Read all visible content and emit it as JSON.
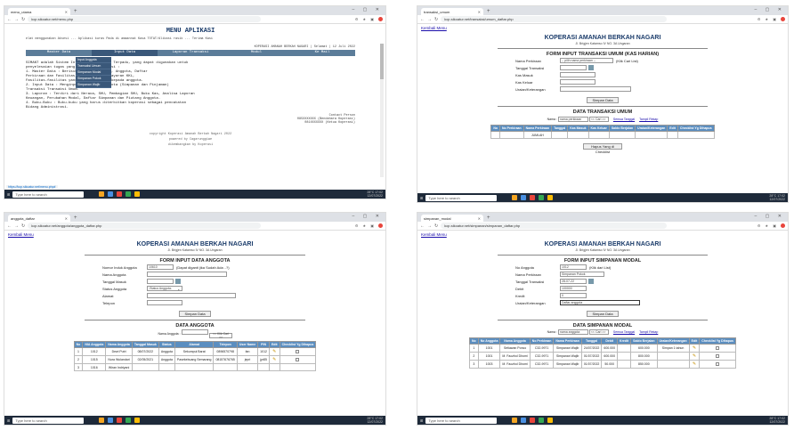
{
  "screen1": {
    "tab_title": "menu_utama",
    "url": "kop.sikoatur.net/menu.php",
    "menu_title": "MENU APLIKASI",
    "marquee_text": "elat menggunakan Aksesi ... Aplikasi kuras Pada di amaannat Kasa TOTAT/Alikasi rasik ... Terima Kasi",
    "header_line": "KOPERASI AMANAH BERKAH NAGARI | Selamat | 12 Juli 2022",
    "nav": [
      "Master Data",
      "Input Data",
      "Laporan Transaksi",
      "Modul",
      "Ke Mail"
    ],
    "dropdown": [
      "Input Anggota",
      "Transaksi Umum",
      "Simpanan Modal",
      "Simpanan Pokok",
      "Simpanan Wajib"
    ],
    "body_lines": [
      "SIMANT adalah Sistem Informasi Manajemen Terpadu, yang dapat digunakan untuk",
      "penyelesaian tugas yang dilakukan Aplikasi :",
      "1. Master Data : Berisikan Data Koperasi, Anggota, Daftar",
      "   Perkiraan dan Fasilitas, Pencatatan Pembayaran KKL,",
      "   Fasilitas-fasilitas yang akan diberikan kepada anggota.",
      "2. Input Data : Menginput Transaksi Anggota (Simpanan dan Pinjaman)",
      "   Transaksi Transaksi Umum.",
      "3. Laporan : Terdiri dari Neraca, SHU, Pembagian SHU, Buku Kas, Analisa Laporan",
      "   Keuangan, Perubahan Modal, Daftar Simpanan dan Piutang Anggota.",
      "4. Buku-Buku : Buku-buku yang harus diterbitkan koperasi sebagai pencatatan",
      "   Bidang Administrasi."
    ],
    "footer_right": [
      "Contact Person",
      "085XXXXXXX (Bendahara Koperasi)",
      "081XXXXXXX (Ketua Koperasi)"
    ],
    "credits": [
      "copyright Koperasi Amanah Berkah Nagari 2022",
      "powered by Cagarunggiwe",
      "dikembangkan by Koperasi"
    ],
    "status_url": "https://kop.sikoatur.net/menu.php#"
  },
  "screen2": {
    "tab_title": "transaksi_umum",
    "url": "kop.sikoatur.net/transaksi/umum_daftar.php",
    "back_link": "Kembali Menu",
    "coop_name": "KOPERASI AMANAH BERKAH NAGARI",
    "coop_address": "Jl. Brigjen Katamso IV NO. 3A Ungaran",
    "form_title": "FORM INPUT TRANSAKSI UMUM (KAS HARIAN)",
    "fields": [
      {
        "label": "Nama Perkiraan",
        "value": "-- pilih nama perkiraan --",
        "extra": "(Klik Cari List)"
      },
      {
        "label": "Tanggal Transaksi",
        "value": ""
      },
      {
        "label": "Kas Masuk",
        "value": ""
      },
      {
        "label": "Kas Keluar",
        "value": ""
      },
      {
        "label": "Uraian/Keterangan",
        "value": ""
      }
    ],
    "save_button": "Simpan Data",
    "table_title": "DATA TRANSAKSI UMUM",
    "search_label": "Nama :",
    "search_placeholder": "nama perkiraan",
    "search_button": "<< Cari >>",
    "links": [
      "Semua Tanggal",
      "Tampil Rekap"
    ],
    "columns": [
      "No",
      "No Perkiraan",
      "Nama Perkiraan",
      "Tanggal",
      "Kas Masuk",
      "Kas Keluar",
      "Saldo Berjalan",
      "Uraian/Keterangan",
      "Edit",
      "Checklist Yg Dihapus"
    ],
    "rows": [
      [
        "",
        "",
        "JUMLAH",
        "",
        "",
        "",
        "",
        "",
        "",
        ""
      ]
    ],
    "delete_button": "Hapus Yang di Checklist"
  },
  "screen3": {
    "tab_title": "anggota_daftar",
    "url": "kop.sikoatur.net/anggota/anggota_daftar.php",
    "back_link": "Kembali Menu",
    "coop_name": "KOPERASI AMANAH BERKAH NAGARI",
    "coop_address": "Jl. Brigjen Katamso IV NO. 3A Ungaran",
    "form_title": "FORM INPUT DATA ANGGOTA",
    "fields": [
      {
        "label": "Nomor Induk Anggota",
        "value": "10610",
        "extra": "(Dapat diganti jika Sudah Ada ..?)"
      },
      {
        "label": "Nama Anggota",
        "value": ""
      },
      {
        "label": "Tanggal Masuk",
        "value": ""
      },
      {
        "label": "Status Anggota",
        "value": "-Status Anggota-"
      },
      {
        "label": "Alamat",
        "value": ""
      },
      {
        "label": "Telepon",
        "value": ""
      }
    ],
    "save_button": "Simpan Data",
    "table_title": "DATA ANGGOTA",
    "search_label": "Nama Anggota :",
    "search_button": "<< Klik Cari >>",
    "columns": [
      "No",
      "NIA Anggota",
      "Nama Anggota",
      "Tanggal Masuk",
      "Status",
      "Alamat",
      "Telepon",
      "User Name",
      "PIN",
      "Edit",
      "Checklist Yg Dihapus"
    ],
    "rows": [
      [
        "1",
        "1012",
        "Dewi Putri",
        "08/07/2022",
        "Anggota",
        "Sekumpul Barat",
        "0896570798",
        "fan",
        "1012"
      ],
      [
        "2",
        "1015",
        "Nura Wulandari",
        "02/05/2021",
        "Anggota",
        "Pasekebuang Semarang",
        "08157676765",
        "jepri",
        "jpr85"
      ],
      [
        "3",
        "1016",
        "Wiran Indriyani",
        "",
        "",
        "",
        "",
        "",
        ""
      ]
    ]
  },
  "screen4": {
    "tab_title": "simpanan_modal",
    "url": "kop.sikoatur.net/simpanan/simpanan_daftar.php",
    "back_link": "Kembali Menu",
    "coop_name": "KOPERASI AMANAH BERKAH NAGARI",
    "coop_address": "Jl. Brigjen Katamso IV NO. 3A Ungaran",
    "form_title": "FORM INPUT SIMPANAN MODAL",
    "fields": [
      {
        "label": "No Anggota",
        "value": "1012",
        "extra": "(Klik dari List)"
      },
      {
        "label": "Nama Perkiraan",
        "value": "Simpanan Pokok"
      },
      {
        "label": "Tanggal Transaksi",
        "value": "28-07-22"
      },
      {
        "label": "Debit",
        "value": "100000"
      },
      {
        "label": "Kredit",
        "value": "0"
      },
      {
        "label": "Uraian/Keterangan",
        "value": "Daftar anggota"
      }
    ],
    "save_button": "Simpan Data",
    "table_title": "DATA SIMPANAN MODAL",
    "search_label": "Nama :",
    "search_placeholder": "nama anggota",
    "search_button": "<< Cari >>",
    "links": [
      "Semua Tanggal",
      "Tampil Rekap"
    ],
    "columns": [
      "No",
      "No Anggota",
      "Nama Anggota",
      "No Perkiraan",
      "Nama Perkiraan",
      "Tanggal",
      "Debit",
      "Kredit",
      "Saldo Berjalan",
      "Uraian/Keterangan",
      "Edit",
      "Checklist Yg Dihapus"
    ],
    "rows": [
      [
        "1",
        "1001",
        "Setiawan Ponco",
        "C32-9971",
        "Simpanan Wajib",
        "24/07/2022",
        "600.000",
        "",
        "600.000",
        "Simpan 1 tahun"
      ],
      [
        "2",
        "1001",
        "M. Faozhol Dhomi",
        "C32-9971",
        "Simpanan Wajib",
        "01/07/2022",
        "600.000",
        "",
        "800.000",
        ""
      ],
      [
        "3",
        "1003",
        "M. Faozhol Dhomi",
        "C32-9971",
        "Simpanan Wajib",
        "01/07/2022",
        "50.000",
        "",
        "850.000",
        ""
      ]
    ]
  },
  "taskbar": {
    "search_placeholder": "Type here to search",
    "weather": "28°C",
    "time": "17:02",
    "date": "12/07/2022"
  },
  "colors": {
    "nav": "#5b7c99",
    "table_header": "#5b8ec0",
    "taskbar": "#1e2a3a"
  }
}
